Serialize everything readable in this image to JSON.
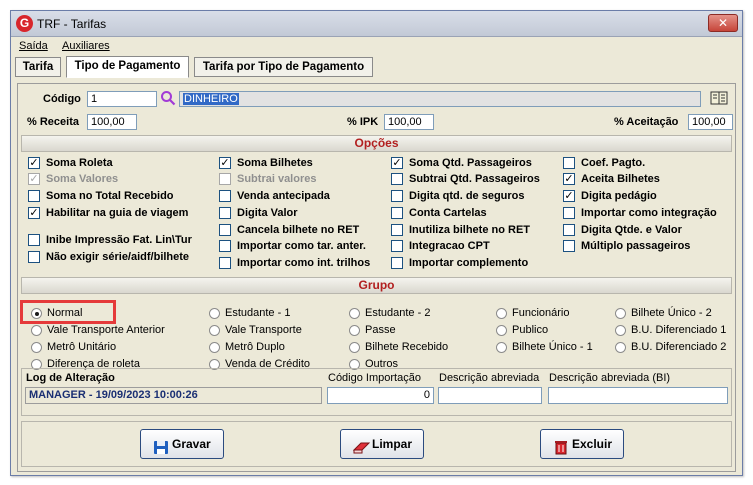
{
  "window": {
    "title": "TRF - Tarifas",
    "icon_letter": "G"
  },
  "menu": {
    "items": [
      "Saída",
      "Auxiliares"
    ]
  },
  "tabs": [
    "Tarifa",
    "Tipo de Pagamento",
    "Tarifa por Tipo de Pagamento"
  ],
  "active_tab": "Tipo de Pagamento",
  "form": {
    "codigo_label": "Código",
    "codigo_value": "1",
    "descricao_value": "DINHEIRO",
    "receita_label": "% Receita",
    "receita_value": "100,00",
    "ipk_label": "% IPK",
    "ipk_value": "100,00",
    "aceitacao_label": "% Aceitação",
    "aceitacao_value": "100,00"
  },
  "opcoes": {
    "header": "Opções",
    "checkboxes": [
      {
        "label": "Soma Roleta",
        "checked": true,
        "disabled": false
      },
      {
        "label": "Soma Valores",
        "checked": true,
        "disabled": true
      },
      {
        "label": "Soma no Total Recebido",
        "checked": false,
        "disabled": false
      },
      {
        "label": "Habilitar na guia de viagem",
        "checked": true,
        "disabled": false
      },
      {
        "label": "Inibe Impressão Fat. Lin\\Tur",
        "checked": false,
        "disabled": false
      },
      {
        "label": "Não exigir série/aidf/bilhete",
        "checked": false,
        "disabled": false
      },
      {
        "label": "Soma Bilhetes",
        "checked": true,
        "disabled": false
      },
      {
        "label": "Subtrai valores",
        "checked": false,
        "disabled": true
      },
      {
        "label": "Venda antecipada",
        "checked": false,
        "disabled": false
      },
      {
        "label": "Digita Valor",
        "checked": false,
        "disabled": false
      },
      {
        "label": "Cancela bilhete no RET",
        "checked": false,
        "disabled": false
      },
      {
        "label": "Importar como tar. anter.",
        "checked": false,
        "disabled": false
      },
      {
        "label": "Importar como int. trilhos",
        "checked": false,
        "disabled": false
      },
      {
        "label": "Soma Qtd. Passageiros",
        "checked": true,
        "disabled": false
      },
      {
        "label": "Subtrai Qtd. Passageiros",
        "checked": false,
        "disabled": false
      },
      {
        "label": "Digita qtd. de seguros",
        "checked": false,
        "disabled": false
      },
      {
        "label": "Conta Cartelas",
        "checked": false,
        "disabled": false
      },
      {
        "label": "Inutiliza bilhete no RET",
        "checked": false,
        "disabled": false
      },
      {
        "label": "Integracao CPT",
        "checked": false,
        "disabled": false
      },
      {
        "label": "Importar complemento",
        "checked": false,
        "disabled": false
      },
      {
        "label": "Coef. Pagto.",
        "checked": false,
        "disabled": false
      },
      {
        "label": "Aceita Bilhetes",
        "checked": true,
        "disabled": false
      },
      {
        "label": "Digita pedágio",
        "checked": true,
        "disabled": false
      },
      {
        "label": "Importar como integração",
        "checked": false,
        "disabled": false
      },
      {
        "label": "Digita Qtde. e Valor",
        "checked": false,
        "disabled": false
      },
      {
        "label": "Múltiplo passageiros",
        "checked": false,
        "disabled": false
      }
    ]
  },
  "grupo": {
    "header": "Grupo",
    "selected": "Normal",
    "radios": [
      "Normal",
      "Vale Transporte Anterior",
      "Metrô Unitário",
      "Diferença de roleta",
      "Estudante - 1",
      "Vale Transporte",
      "Metrô Duplo",
      "Venda de Crédito",
      "Estudante - 2",
      "Passe",
      "Bilhete Recebido",
      "Outros",
      "Funcionário",
      "Publico",
      "Bilhete Único - 1",
      "Bilhete Único - 2",
      "B.U. Diferenciado 1",
      "B.U. Diferenciado 2"
    ]
  },
  "log": {
    "title": "Log de Alteração",
    "value": "MANAGER - 19/09/2023 10:00:26",
    "codigo_importacao_label": "Código Importação",
    "codigo_importacao_value": "0",
    "descricao_abreviada_label": "Descrição abreviada",
    "descricao_abreviada_value": "",
    "descricao_abreviada_bi_label": "Descrição abreviada (BI)",
    "descricao_abreviada_bi_value": ""
  },
  "buttons": {
    "gravar": "Gravar",
    "limpar": "Limpar",
    "excluir": "Excluir"
  },
  "colors": {
    "section_header_text": "#b22020",
    "highlight": "#e53a3a",
    "log_value": "#1a2f73"
  }
}
